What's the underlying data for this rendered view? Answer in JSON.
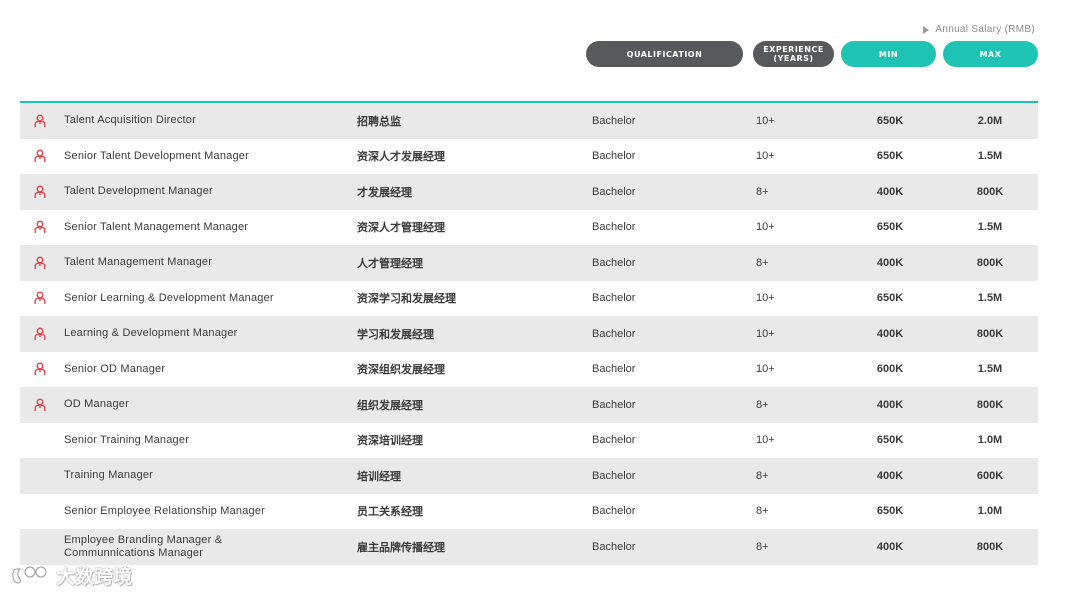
{
  "legend": {
    "label": "Annual Salary (RMB)",
    "marker": "triangle-right-icon"
  },
  "columns": {
    "qualification": "QUALIFICATION",
    "experience_line1": "EXPERIENCE",
    "experience_line2": "(YEARS)",
    "min": "MIN",
    "max": "MAX"
  },
  "colors": {
    "accent": "#1ec3b3",
    "dark_pill": "#58595b",
    "row_shade": "#e9e9e9",
    "icon": "#e8424a"
  },
  "rows": [
    {
      "icon": "person-icon",
      "title": "Talent Acquisition Director",
      "cn": "招聘总监",
      "qualification": "Bachelor",
      "experience": "10+",
      "min": "650K",
      "max": "2.0M"
    },
    {
      "icon": "person-icon",
      "title": "Senior Talent Development Manager",
      "cn": "资深人才发展经理",
      "qualification": "Bachelor",
      "experience": "10+",
      "min": "650K",
      "max": "1.5M"
    },
    {
      "icon": "person-icon",
      "title": "Talent Development Manager",
      "cn": "才发展经理",
      "qualification": "Bachelor",
      "experience": "8+",
      "min": "400K",
      "max": "800K"
    },
    {
      "icon": "person-icon",
      "title": "Senior Talent Management Manager",
      "cn": "资深人才管理经理",
      "qualification": "Bachelor",
      "experience": "10+",
      "min": "650K",
      "max": "1.5M"
    },
    {
      "icon": "person-icon",
      "title": "Talent Management Manager",
      "cn": "人才管理经理",
      "qualification": "Bachelor",
      "experience": "8+",
      "min": "400K",
      "max": "800K"
    },
    {
      "icon": "person-icon",
      "title": "Senior Learning & Development Manager",
      "cn": "资深学习和发展经理",
      "qualification": "Bachelor",
      "experience": "10+",
      "min": "650K",
      "max": "1.5M"
    },
    {
      "icon": "person-icon",
      "title": "Learning & Development Manager",
      "cn": "学习和发展经理",
      "qualification": "Bachelor",
      "experience": "10+",
      "min": "400K",
      "max": "800K"
    },
    {
      "icon": "person-icon",
      "title": "Senior OD Manager",
      "cn": "资深组织发展经理",
      "qualification": "Bachelor",
      "experience": "10+",
      "min": "600K",
      "max": "1.5M"
    },
    {
      "icon": "person-icon",
      "title": "OD Manager",
      "cn": "组织发展经理",
      "qualification": "Bachelor",
      "experience": "8+",
      "min": "400K",
      "max": "800K"
    },
    {
      "icon": "",
      "title": "Senior Training Manager",
      "cn": "资深培训经理",
      "qualification": "Bachelor",
      "experience": "10+",
      "min": "650K",
      "max": "1.0M"
    },
    {
      "icon": "",
      "title": "Training Manager",
      "cn": "培训经理",
      "qualification": "Bachelor",
      "experience": "8+",
      "min": "400K",
      "max": "600K"
    },
    {
      "icon": "",
      "title": "Senior Employee Relationship Manager",
      "cn": "员工关系经理",
      "qualification": "Bachelor",
      "experience": "8+",
      "min": "650K",
      "max": "1.0M"
    },
    {
      "icon": "",
      "title_line1": "Employee Branding Manager &",
      "title_line2": "Communnications Manager",
      "cn": "雇主品牌传播经理",
      "qualification": "Bachelor",
      "experience": "8+",
      "min": "400K",
      "max": "800K"
    }
  ],
  "watermark": {
    "text": "大数跨境",
    "logo": "watermark-logo-icon"
  }
}
